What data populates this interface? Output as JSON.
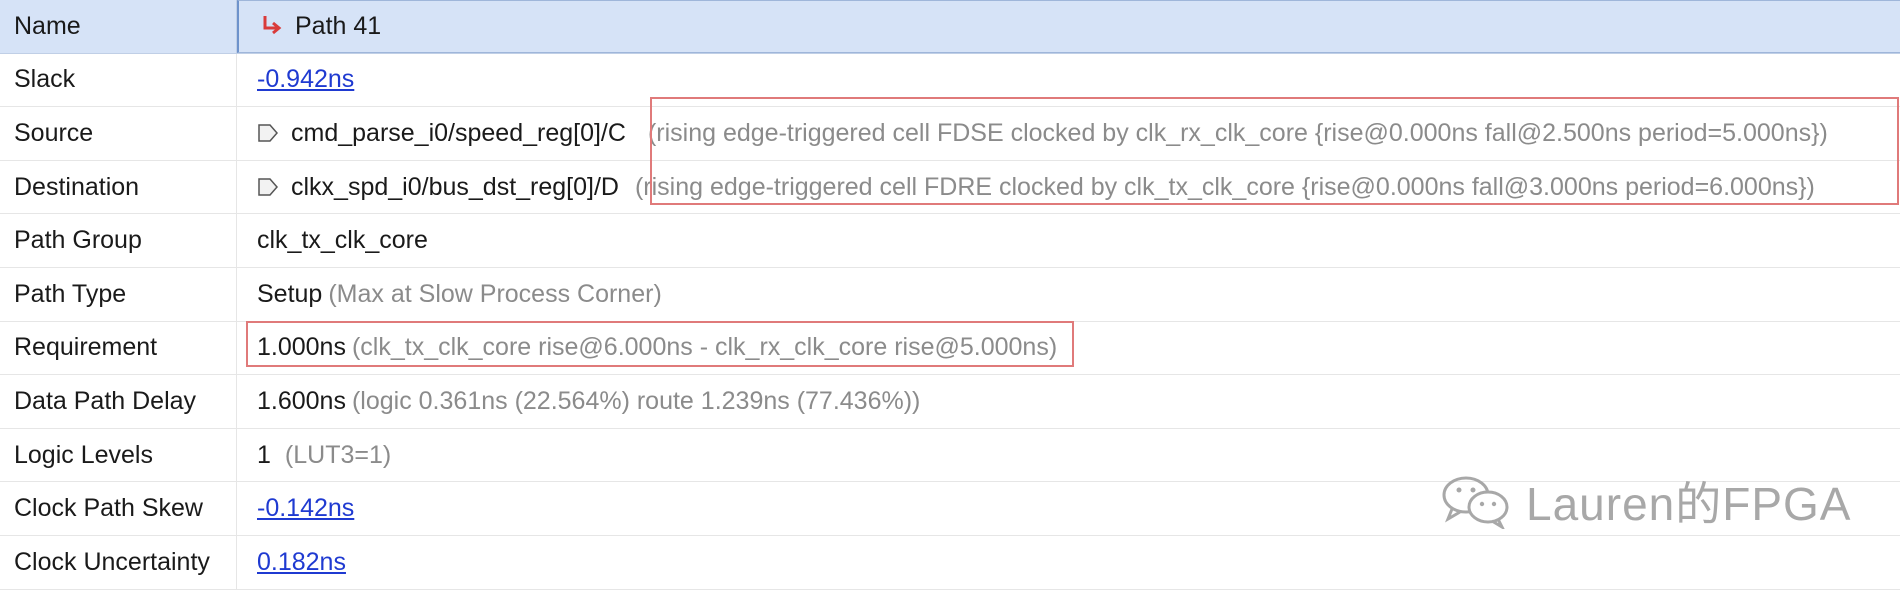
{
  "rows": [
    {
      "name": "Name",
      "value": "Path 41"
    },
    {
      "name": "Slack",
      "value": "-0.942ns"
    },
    {
      "name": "Source",
      "value": "cmd_parse_i0/speed_reg[0]/C",
      "detail": "(rising edge-triggered cell FDSE clocked by clk_rx_clk_core  {rise@0.000ns fall@2.500ns period=5.000ns})"
    },
    {
      "name": "Destination",
      "value": "clkx_spd_i0/bus_dst_reg[0]/D",
      "detail": "(rising edge-triggered cell FDRE clocked by clk_tx_clk_core  {rise@0.000ns fall@3.000ns period=6.000ns})"
    },
    {
      "name": "Path Group",
      "value": "clk_tx_clk_core"
    },
    {
      "name": "Path Type",
      "value": "Setup",
      "detail": "(Max at Slow Process Corner)"
    },
    {
      "name": "Requirement",
      "value": "1.000ns",
      "detail": "(clk_tx_clk_core rise@6.000ns - clk_rx_clk_core rise@5.000ns)"
    },
    {
      "name": "Data Path Delay",
      "value": "1.600ns",
      "detail": "(logic 0.361ns (22.564%)  route 1.239ns (77.436%))"
    },
    {
      "name": "Logic Levels",
      "value": "1",
      "detail": "(LUT3=1)"
    },
    {
      "name": "Clock Path Skew",
      "value": "-0.142ns"
    },
    {
      "name": "Clock Uncertainty",
      "value": "0.182ns"
    }
  ],
  "watermark": "Lauren的FPGA",
  "icons": {
    "path": "path-icon",
    "port": "port-icon",
    "wechat": "wechat-icon"
  },
  "colors": {
    "selection": "#d6e3f7",
    "link": "#1f3ad1",
    "highlight_box": "#e07a7a",
    "path_icon": "#d93b3b"
  }
}
